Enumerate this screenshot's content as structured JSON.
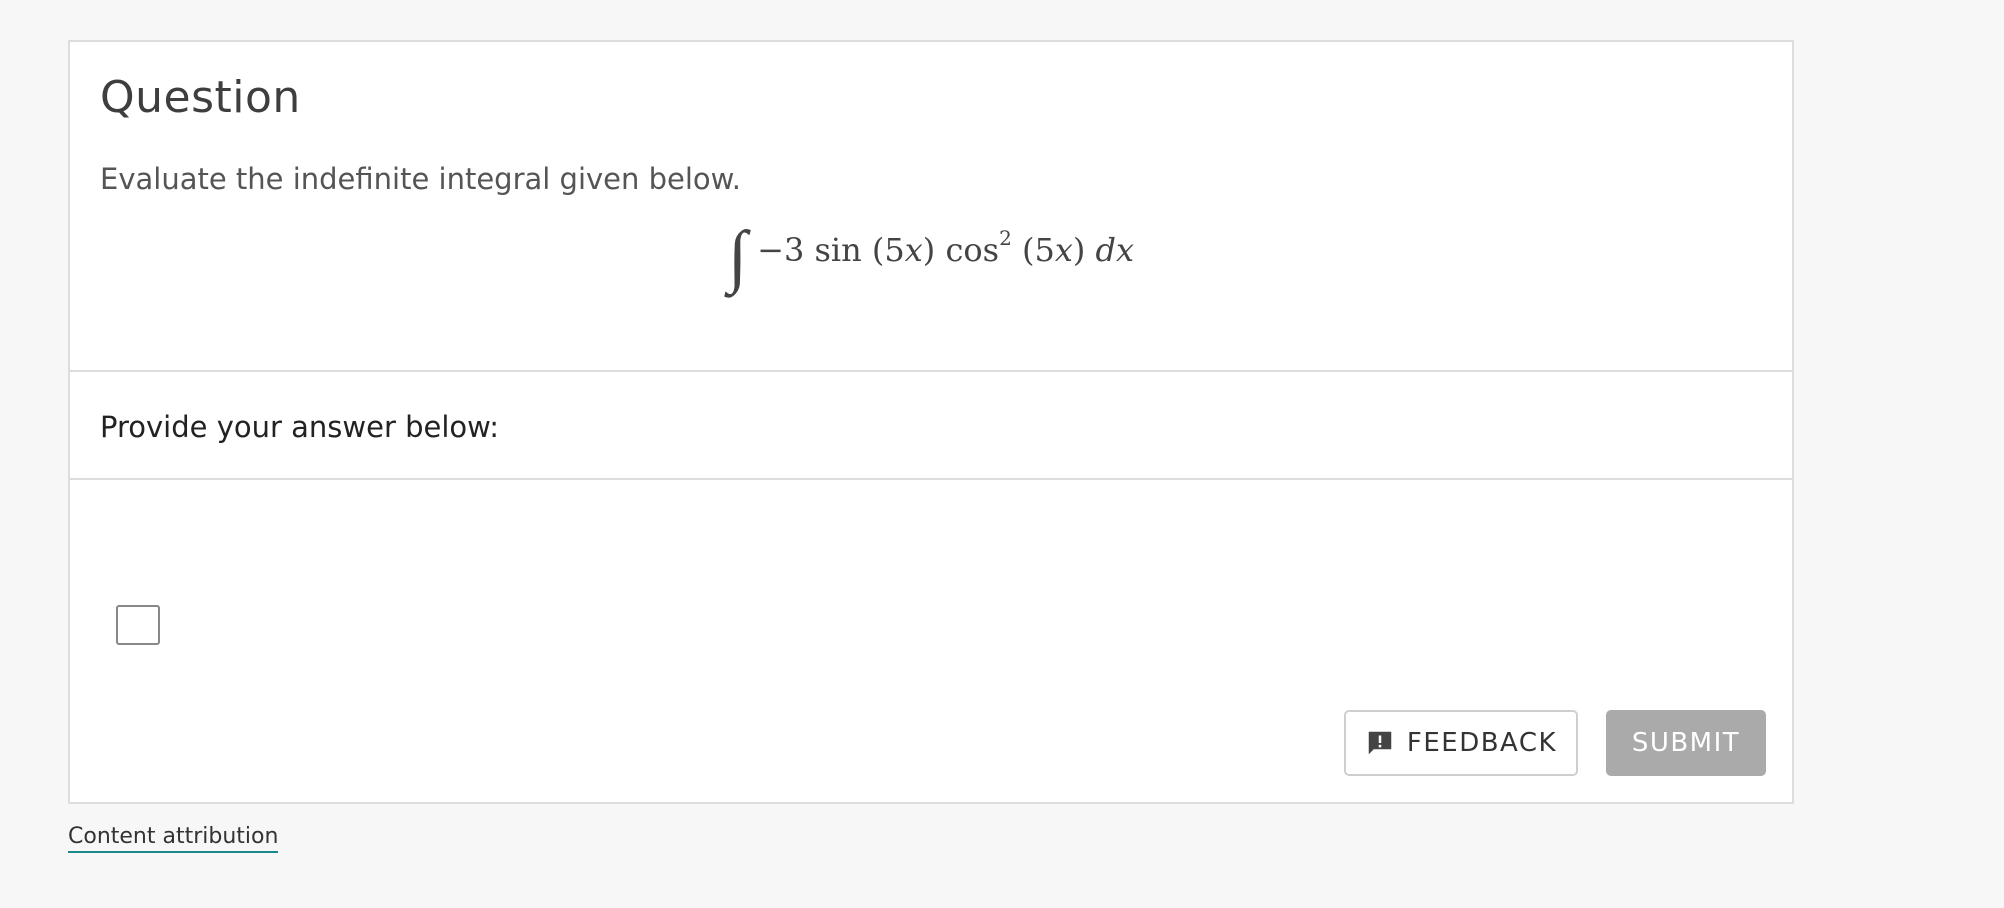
{
  "question": {
    "title": "Question",
    "prompt": "Evaluate the indefinite integral given below.",
    "integral": {
      "sign": "∫",
      "coef": "−3 sin (5",
      "var1": "x",
      "mid": ") cos",
      "exponent": "2",
      "arg_open": " (5",
      "var2": "x",
      "arg_close": ") ",
      "differential": "dx"
    }
  },
  "answer": {
    "label": "Provide your answer below:",
    "value": ""
  },
  "actions": {
    "feedback_label": "FEEDBACK",
    "feedback_icon": "feedback-icon",
    "submit_label": "SUBMIT"
  },
  "footer": {
    "attribution_label": "Content attribution"
  },
  "colors": {
    "submit_bg": "#aaaaaa",
    "attribution_underline": "#1b8a8a"
  }
}
